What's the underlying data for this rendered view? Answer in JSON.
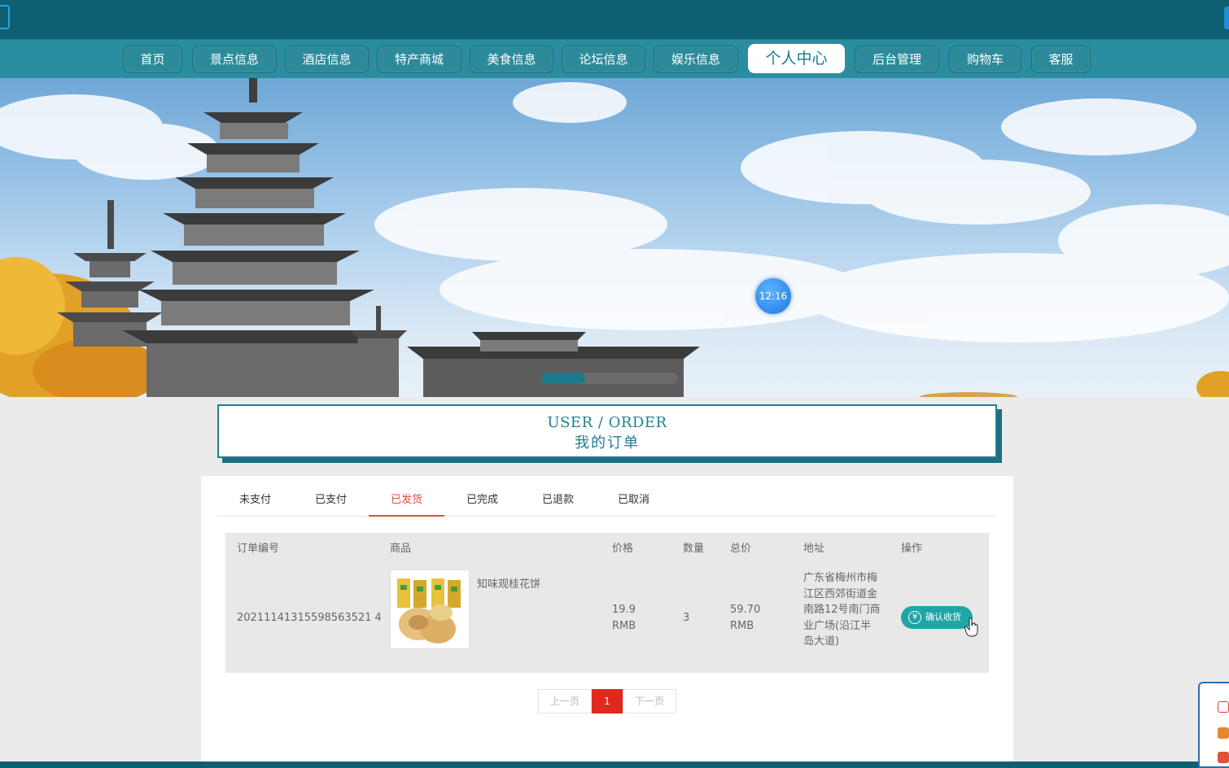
{
  "nav": {
    "items": [
      {
        "label": "首页"
      },
      {
        "label": "景点信息"
      },
      {
        "label": "酒店信息"
      },
      {
        "label": "特产商城"
      },
      {
        "label": "美食信息"
      },
      {
        "label": "论坛信息"
      },
      {
        "label": "娱乐信息"
      },
      {
        "label": "个人中心",
        "active": true
      },
      {
        "label": "后台管理"
      },
      {
        "label": "购物车"
      },
      {
        "label": "客服"
      }
    ]
  },
  "banner": {
    "timer": "12:16"
  },
  "page_title": {
    "en": "USER / ORDER",
    "cn": "我的订单"
  },
  "tabs": [
    {
      "label": "未支付"
    },
    {
      "label": "已支付"
    },
    {
      "label": "已发货",
      "active": true
    },
    {
      "label": "已完成"
    },
    {
      "label": "已退款"
    },
    {
      "label": "已取消"
    }
  ],
  "table": {
    "headers": {
      "order_no": "订单编号",
      "product": "商品",
      "price": "价格",
      "qty": "数量",
      "total": "总价",
      "address": "地址",
      "action": "操作"
    },
    "rows": [
      {
        "order_no": "20211141315598563521 4",
        "product_name": "知味观桂花饼",
        "price": "19.9",
        "price_unit": "RMB",
        "qty": "3",
        "total": "59.70",
        "total_unit": "RMB",
        "address": "广东省梅州市梅江区西郊街道金南路12号南门商业广场(沿江半岛大道)",
        "action_label": "确认收货",
        "action_icon": "¥"
      }
    ]
  },
  "pager": {
    "prev": "上一页",
    "current": "1",
    "next": "下一页"
  },
  "colors": {
    "topbar": "#0f5f72",
    "nav": "#2a8ea0",
    "accent": "#1f7f91",
    "tab_active": "#e34d3a",
    "pager_current": "#e0281c",
    "confirm_button": "#20a6a6"
  }
}
